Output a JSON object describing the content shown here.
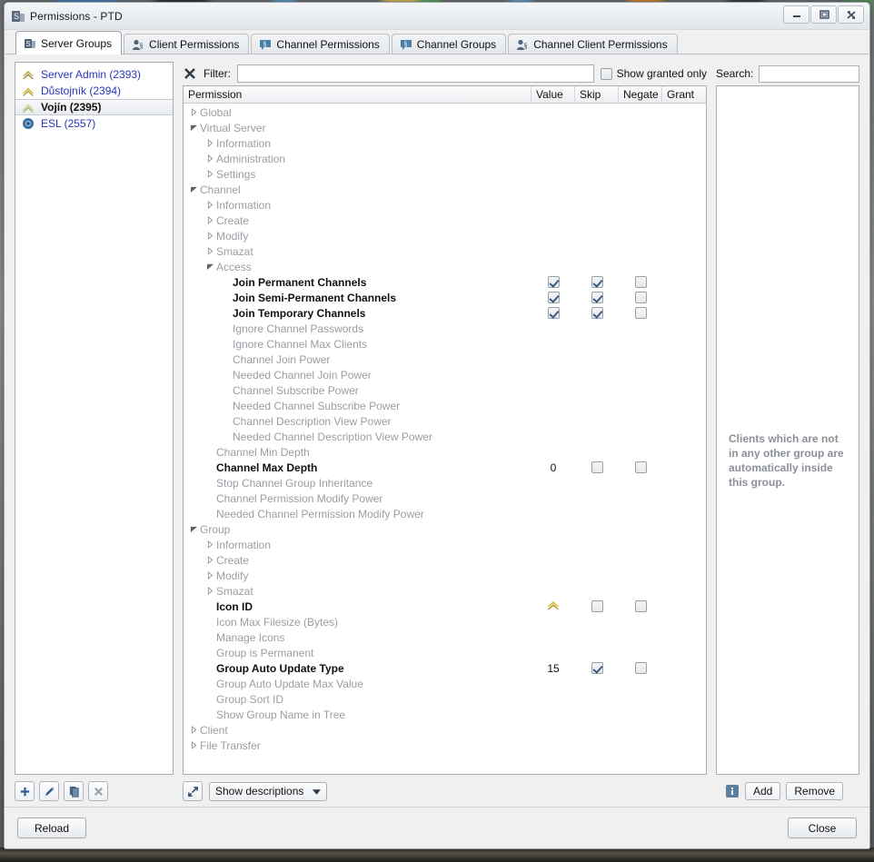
{
  "window": {
    "title": "Permissions - PTD",
    "icon": "teamspeak-permissions-icon",
    "minimize_label": "minimize-icon",
    "maximize_label": "maximize-icon",
    "close_label": "close-icon"
  },
  "tabs": [
    {
      "label": "Server Groups",
      "icon": "server-groups-icon",
      "active": true
    },
    {
      "label": "Client Permissions",
      "icon": "client-permissions-icon",
      "active": false
    },
    {
      "label": "Channel Permissions",
      "icon": "channel-permissions-icon",
      "active": false
    },
    {
      "label": "Channel Groups",
      "icon": "channel-groups-icon",
      "active": false
    },
    {
      "label": "Channel Client Permissions",
      "icon": "channel-client-permissions-icon",
      "active": false
    }
  ],
  "groups": {
    "items": [
      {
        "label": "Server Admin (2393)",
        "icon": "rank-insignia-icon",
        "selected": false
      },
      {
        "label": "Důstojník (2394)",
        "icon": "rank-insignia-icon",
        "selected": false
      },
      {
        "label": "Vojín (2395)",
        "icon": "rank-insignia-icon",
        "selected": true
      },
      {
        "label": "ESL (2557)",
        "icon": "esl-badge-icon",
        "selected": false
      }
    ],
    "buttons": [
      {
        "name": "add-group-button",
        "icon": "plus-icon"
      },
      {
        "name": "edit-group-button",
        "icon": "pencil-icon"
      },
      {
        "name": "copy-group-button",
        "icon": "copy-icon"
      },
      {
        "name": "delete-group-button",
        "icon": "x-icon"
      }
    ]
  },
  "filter": {
    "clear_icon": "clear-filter-icon",
    "label": "Filter:",
    "value": "",
    "placeholder": "",
    "granted_only_label": "Show granted only",
    "granted_only_checked": false
  },
  "permissions": {
    "columns": [
      "Permission",
      "Value",
      "Skip",
      "Negate",
      "Grant"
    ],
    "rows": [
      {
        "label": "Global",
        "indent": 0,
        "state": "collapsed",
        "set": false
      },
      {
        "label": "Virtual Server",
        "indent": 0,
        "state": "expanded",
        "set": false
      },
      {
        "label": "Information",
        "indent": 1,
        "state": "collapsed",
        "set": false
      },
      {
        "label": "Administration",
        "indent": 1,
        "state": "collapsed",
        "set": false
      },
      {
        "label": "Settings",
        "indent": 1,
        "state": "collapsed",
        "set": false
      },
      {
        "label": "Channel",
        "indent": 0,
        "state": "expanded",
        "set": false
      },
      {
        "label": "Information",
        "indent": 1,
        "state": "collapsed",
        "set": false
      },
      {
        "label": "Create",
        "indent": 1,
        "state": "collapsed",
        "set": false
      },
      {
        "label": "Modify",
        "indent": 1,
        "state": "collapsed",
        "set": false
      },
      {
        "label": "Smazat",
        "indent": 1,
        "state": "collapsed",
        "set": false
      },
      {
        "label": "Access",
        "indent": 1,
        "state": "expanded",
        "set": false
      },
      {
        "label": "Join Permanent Channels",
        "indent": 2,
        "state": "leaf",
        "set": true,
        "value_checked": true,
        "skip_checked": true,
        "negate_checked": false
      },
      {
        "label": "Join Semi-Permanent Channels",
        "indent": 2,
        "state": "leaf",
        "set": true,
        "value_checked": true,
        "skip_checked": true,
        "negate_checked": false
      },
      {
        "label": "Join Temporary Channels",
        "indent": 2,
        "state": "leaf",
        "set": true,
        "value_checked": true,
        "skip_checked": true,
        "negate_checked": false
      },
      {
        "label": "Ignore Channel Passwords",
        "indent": 2,
        "state": "leaf",
        "set": false
      },
      {
        "label": "Ignore Channel Max Clients",
        "indent": 2,
        "state": "leaf",
        "set": false
      },
      {
        "label": "Channel Join Power",
        "indent": 2,
        "state": "leaf",
        "set": false
      },
      {
        "label": "Needed Channel Join Power",
        "indent": 2,
        "state": "leaf",
        "set": false
      },
      {
        "label": "Channel Subscribe Power",
        "indent": 2,
        "state": "leaf",
        "set": false
      },
      {
        "label": "Needed Channel Subscribe Power",
        "indent": 2,
        "state": "leaf",
        "set": false
      },
      {
        "label": "Channel Description View Power",
        "indent": 2,
        "state": "leaf",
        "set": false
      },
      {
        "label": "Needed Channel Description View Power",
        "indent": 2,
        "state": "leaf",
        "set": false
      },
      {
        "label": "Channel Min Depth",
        "indent": 1,
        "state": "leaf",
        "set": false
      },
      {
        "label": "Channel Max Depth",
        "indent": 1,
        "state": "leaf",
        "set": true,
        "value_text": "0",
        "skip_checked": false,
        "negate_checked": false
      },
      {
        "label": "Stop Channel Group Inheritance",
        "indent": 1,
        "state": "leaf",
        "set": false
      },
      {
        "label": "Channel Permission Modify Power",
        "indent": 1,
        "state": "leaf",
        "set": false
      },
      {
        "label": "Needed Channel Permission Modify Power",
        "indent": 1,
        "state": "leaf",
        "set": false
      },
      {
        "label": "Group",
        "indent": 0,
        "state": "expanded",
        "set": false
      },
      {
        "label": "Information",
        "indent": 1,
        "state": "collapsed",
        "set": false
      },
      {
        "label": "Create",
        "indent": 1,
        "state": "collapsed",
        "set": false
      },
      {
        "label": "Modify",
        "indent": 1,
        "state": "collapsed",
        "set": false
      },
      {
        "label": "Smazat",
        "indent": 1,
        "state": "collapsed",
        "set": false
      },
      {
        "label": "Icon ID",
        "indent": 1,
        "state": "leaf",
        "set": true,
        "value_icon": "rank-insignia-icon",
        "skip_checked": false,
        "negate_checked": false
      },
      {
        "label": "Icon Max Filesize (Bytes)",
        "indent": 1,
        "state": "leaf",
        "set": false
      },
      {
        "label": "Manage Icons",
        "indent": 1,
        "state": "leaf",
        "set": false
      },
      {
        "label": "Group is Permanent",
        "indent": 1,
        "state": "leaf",
        "set": false
      },
      {
        "label": "Group Auto Update Type",
        "indent": 1,
        "state": "leaf",
        "set": true,
        "value_text": "15",
        "skip_checked": true,
        "negate_checked": false
      },
      {
        "label": "Group Auto Update Max Value",
        "indent": 1,
        "state": "leaf",
        "set": false
      },
      {
        "label": "Group Sort ID",
        "indent": 1,
        "state": "leaf",
        "set": false
      },
      {
        "label": "Show Group Name in Tree",
        "indent": 1,
        "state": "leaf",
        "set": false
      },
      {
        "label": "Client",
        "indent": 0,
        "state": "collapsed",
        "set": false
      },
      {
        "label": "File Transfer",
        "indent": 0,
        "state": "collapsed",
        "set": false
      }
    ]
  },
  "clients": {
    "search_label": "Search:",
    "search_value": "",
    "search_placeholder": "",
    "hint": "Clients which are not in any other group are automatically inside this group.",
    "add_label": "Add",
    "remove_label": "Remove"
  },
  "toolbar": {
    "expand_icon": "expand-arrows-icon",
    "descriptions_label": "Show descriptions",
    "dropdown_icon": "chevron-down-icon",
    "info_icon": "info-icon"
  },
  "footer": {
    "reload_label": "Reload",
    "close_label": "Close"
  },
  "colors": {
    "group_link": "#2736b8",
    "check": "#3b5a85",
    "disabled_text": "#999ea4",
    "rank_gold": "#c9a227"
  }
}
